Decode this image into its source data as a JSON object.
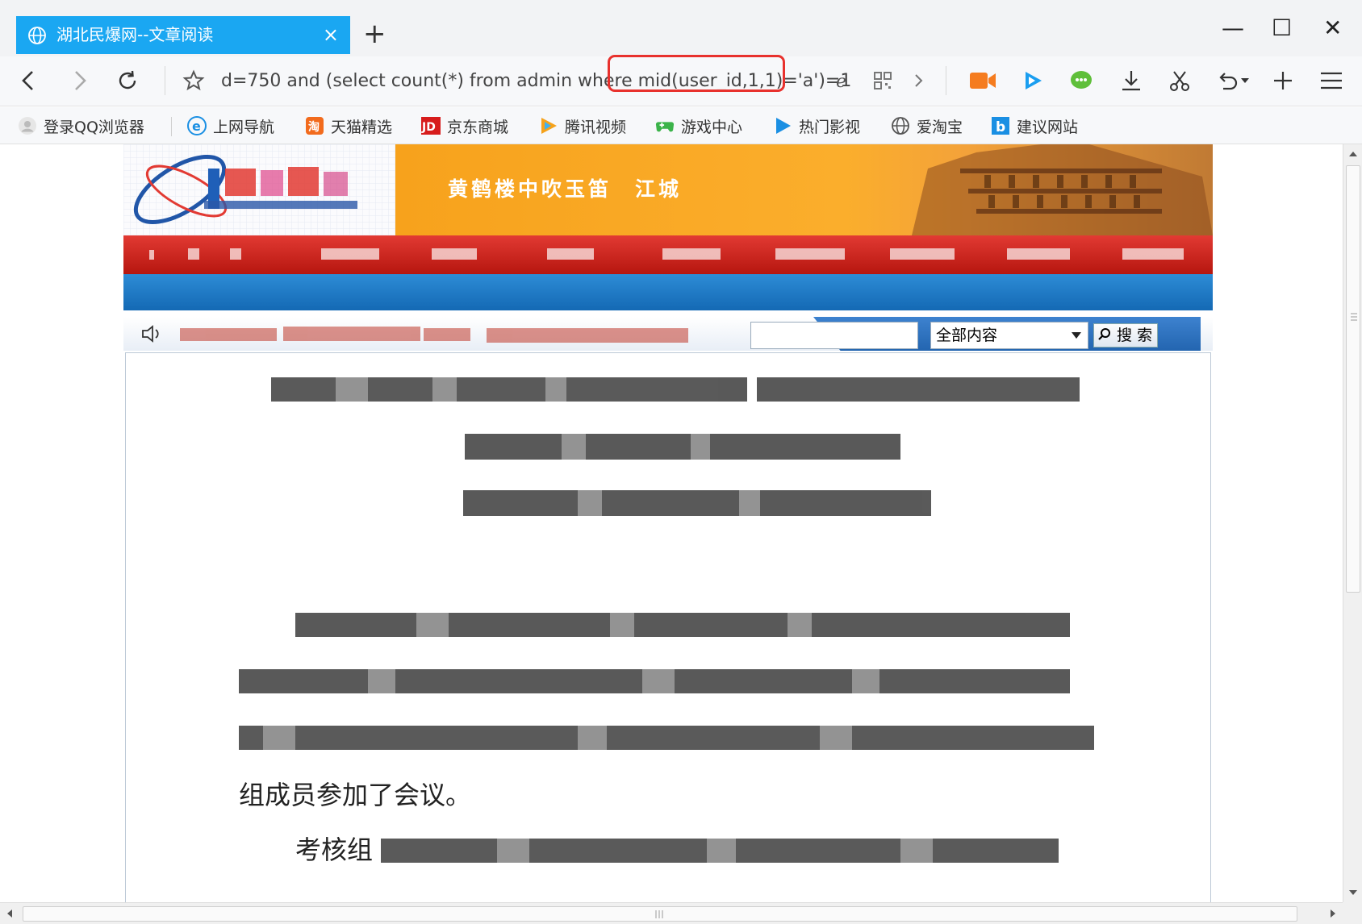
{
  "browser": {
    "tab_title": "湖北民爆网--文章阅读",
    "tab_close": "×",
    "new_tab": "+",
    "win_min": "—",
    "win_max": "☐",
    "win_close": "✕",
    "address_url": "d=750 and (select count(*) from admin where mid(user_id,1,1)='a')=1"
  },
  "bookmarks": [
    {
      "label": "登录QQ浏览器",
      "icon": "user-icon"
    },
    {
      "label": "上网导航",
      "icon": "ie-icon"
    },
    {
      "label": "天猫精选",
      "icon": "tmall-icon"
    },
    {
      "label": "京东商城",
      "icon": "jd-icon"
    },
    {
      "label": "腾讯视频",
      "icon": "tencent-video-icon"
    },
    {
      "label": "游戏中心",
      "icon": "gamepad-icon"
    },
    {
      "label": "热门影视",
      "icon": "play-icon"
    },
    {
      "label": "爱淘宝",
      "icon": "globe-icon"
    },
    {
      "label": "建议网站",
      "icon": "bing-icon"
    }
  ],
  "site": {
    "slogan": "黄鹤楼中吹玉笛　江城",
    "search": {
      "scope_selected": "全部内容",
      "button_label": "搜 索"
    },
    "article": {
      "body_line_4": "组成员参加了会议。",
      "body_line_5_start": "考核组"
    }
  },
  "colors": {
    "tab_active": "#1aa7f2",
    "highlight_box": "#e8312d",
    "nav_red": "#c8201a",
    "nav_blue": "#1f78c4",
    "banner_orange": "#f9a825"
  }
}
